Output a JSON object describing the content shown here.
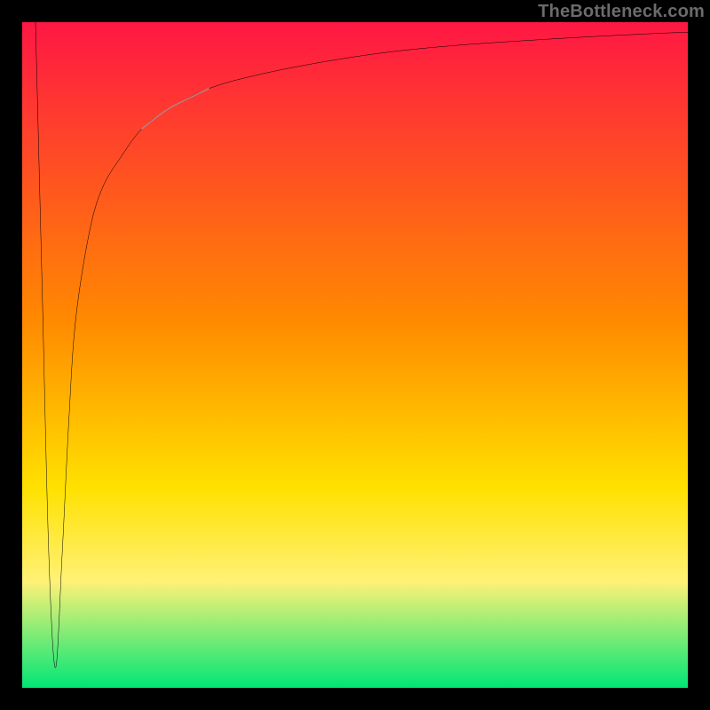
{
  "watermark": "TheBottleneck.com",
  "colors": {
    "black": "#000000",
    "curve": "#000000",
    "highlight": "#b97f7c",
    "grad_top": "#ff1744",
    "grad_mid1": "#ff8a00",
    "grad_mid2": "#ffe100",
    "grad_mid3": "#fff176",
    "grad_bottom": "#00e676"
  },
  "chart_data": {
    "type": "line",
    "title": "",
    "xlabel": "",
    "ylabel": "",
    "xlim": [
      0,
      100
    ],
    "ylim": [
      0,
      100
    ],
    "series": [
      {
        "name": "curve",
        "x": [
          2,
          3,
          4,
          5,
          6,
          7,
          8,
          10,
          12,
          15,
          18,
          22,
          28,
          35,
          45,
          55,
          65,
          75,
          85,
          95,
          100
        ],
        "y": [
          100,
          60,
          20,
          3,
          20,
          40,
          55,
          68,
          75,
          80,
          84,
          87,
          90,
          92,
          94,
          95.5,
          96.5,
          97.2,
          97.8,
          98.3,
          98.5
        ]
      }
    ],
    "highlight_segment": {
      "x_start": 18,
      "x_end": 28,
      "y_start": 84,
      "y_end": 90
    }
  }
}
